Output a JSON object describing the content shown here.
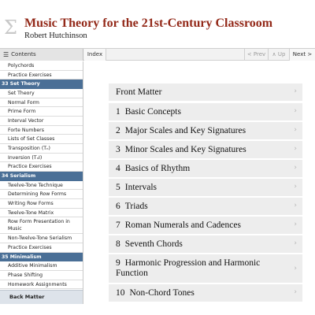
{
  "header": {
    "logo_glyph": "Σ",
    "title": "Music Theory for the 21st-Century Classroom",
    "author": "Robert Hutchinson"
  },
  "toolbar": {
    "contents_icon": "☰",
    "contents_label": "Contents",
    "index_label": "Index",
    "prev_label": "< Prev",
    "up_label": "∧ Up",
    "next_label": "Next >"
  },
  "sidebar": {
    "items": [
      {
        "kind": "item",
        "label": "Polychords"
      },
      {
        "kind": "item",
        "label": "Practice Exercises"
      },
      {
        "kind": "section",
        "label": "33 Set Theory"
      },
      {
        "kind": "item",
        "label": "Set Theory"
      },
      {
        "kind": "item",
        "label": "Normal Form"
      },
      {
        "kind": "item",
        "label": "Prime Form"
      },
      {
        "kind": "item",
        "label": "Interval Vector"
      },
      {
        "kind": "item",
        "label": "Forte Numbers"
      },
      {
        "kind": "item",
        "label": "Lists of Set Classes"
      },
      {
        "kind": "item",
        "label": "Transposition (Tₙ)"
      },
      {
        "kind": "item",
        "label": "Inversion (TₙI)"
      },
      {
        "kind": "item",
        "label": "Practice Exercises"
      },
      {
        "kind": "section",
        "label": "34 Serialism"
      },
      {
        "kind": "item",
        "label": "Twelve-Tone Technique"
      },
      {
        "kind": "item",
        "label": "Determining Row Forms"
      },
      {
        "kind": "item",
        "label": "Writing Row Forms"
      },
      {
        "kind": "item",
        "label": "Twelve-Tone Matrix"
      },
      {
        "kind": "item2",
        "label": "Row Form Presentation in Music"
      },
      {
        "kind": "item",
        "label": "Non-Twelve-Tone Serialism"
      },
      {
        "kind": "item",
        "label": "Practice Exercises"
      },
      {
        "kind": "section",
        "label": "35 Minimalism"
      },
      {
        "kind": "item",
        "label": "Additive Minimalism"
      },
      {
        "kind": "item",
        "label": "Phase Shifting"
      },
      {
        "kind": "item",
        "label": "Homework Assignments"
      }
    ],
    "back_matter": "Back Matter"
  },
  "main": {
    "chevron": "›",
    "rows": [
      {
        "num": "",
        "label": "Front Matter"
      },
      {
        "num": "1",
        "label": "Basic Concepts"
      },
      {
        "num": "2",
        "label": "Major Scales and Key Signatures"
      },
      {
        "num": "3",
        "label": "Minor Scales and Key Signatures"
      },
      {
        "num": "4",
        "label": "Basics of Rhythm"
      },
      {
        "num": "5",
        "label": "Intervals"
      },
      {
        "num": "6",
        "label": "Triads"
      },
      {
        "num": "7",
        "label": "Roman Numerals and Cadences"
      },
      {
        "num": "8",
        "label": "Seventh Chords"
      },
      {
        "num": "9",
        "label": "Harmonic Progression and Harmonic Function"
      },
      {
        "num": "10",
        "label": "Non-Chord Tones"
      }
    ]
  }
}
